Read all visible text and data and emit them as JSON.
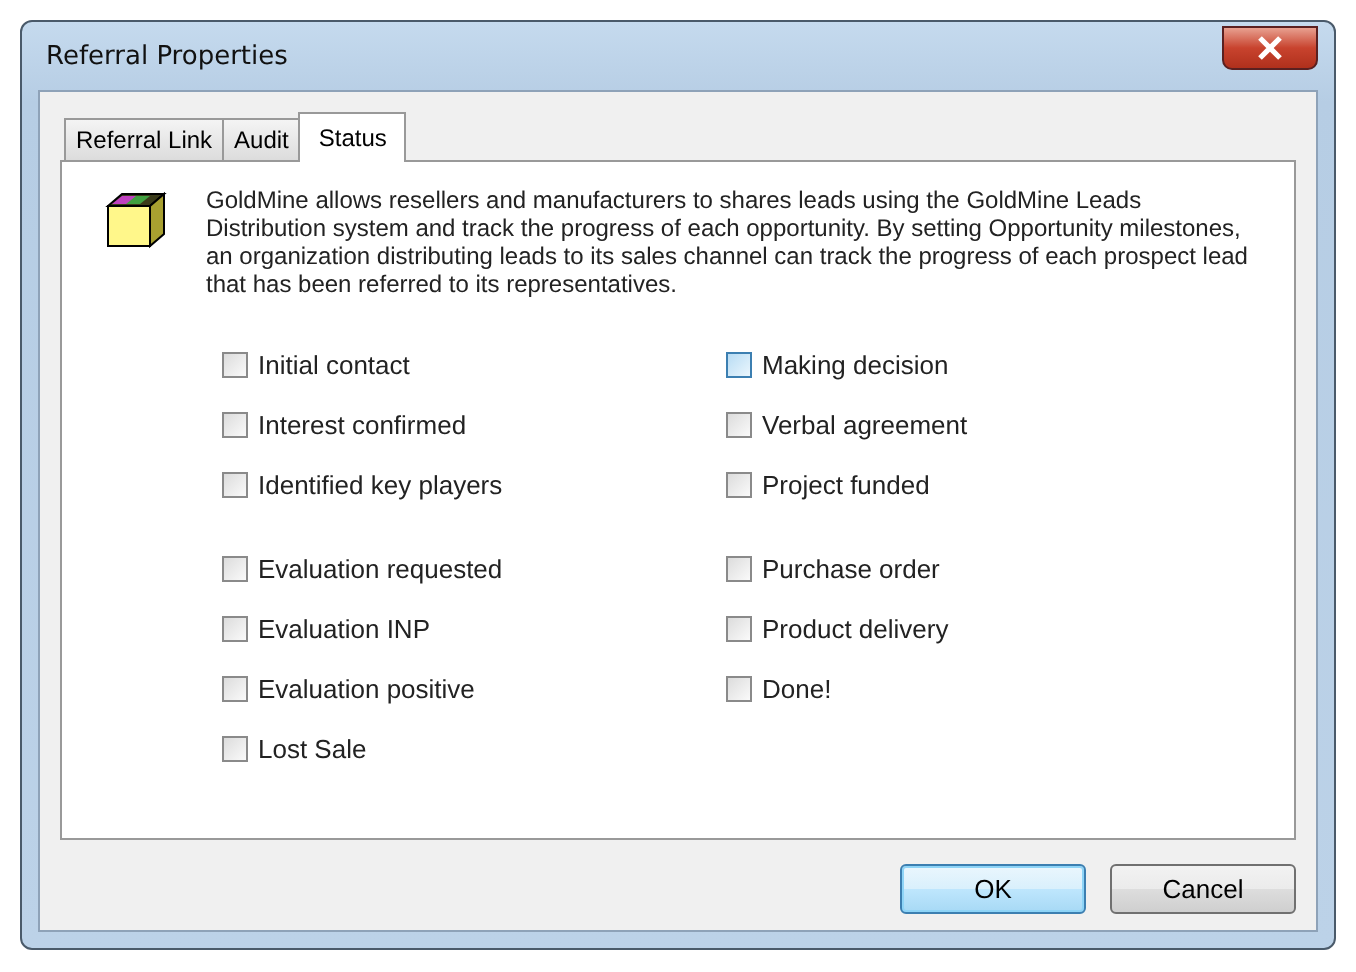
{
  "window": {
    "title": "Referral Properties"
  },
  "tabs": [
    {
      "label": "Referral Link",
      "selected": false
    },
    {
      "label": "Audit",
      "selected": false
    },
    {
      "label": "Status",
      "selected": true
    }
  ],
  "description": "GoldMine allows resellers and manufacturers to shares leads using the GoldMine Leads Distribution system and track the progress of each opportunity.  By setting Opportunity milestones, an organization distributing leads to its sales channel can track the progress of each prospect lead that has been referred to its representatives.",
  "milestone_groups": [
    {
      "left": [
        {
          "label": "Initial contact",
          "checked": false,
          "hovered": false
        },
        {
          "label": "Interest confirmed",
          "checked": false,
          "hovered": false
        },
        {
          "label": "Identified key players",
          "checked": false,
          "hovered": false
        }
      ],
      "right": [
        {
          "label": "Making decision",
          "checked": false,
          "hovered": true
        },
        {
          "label": "Verbal agreement",
          "checked": false,
          "hovered": false
        },
        {
          "label": "Project funded",
          "checked": false,
          "hovered": false
        }
      ]
    },
    {
      "left": [
        {
          "label": "Evaluation requested",
          "checked": false,
          "hovered": false
        },
        {
          "label": "Evaluation INP",
          "checked": false,
          "hovered": false
        },
        {
          "label": "Evaluation positive",
          "checked": false,
          "hovered": false
        },
        {
          "label": "Lost Sale",
          "checked": false,
          "hovered": false
        }
      ],
      "right": [
        {
          "label": "Purchase order",
          "checked": false,
          "hovered": false
        },
        {
          "label": "Product delivery",
          "checked": false,
          "hovered": false
        },
        {
          "label": "Done!",
          "checked": false,
          "hovered": false
        }
      ]
    }
  ],
  "buttons": [
    {
      "label": "OK",
      "default": true
    },
    {
      "label": "Cancel",
      "default": false
    }
  ]
}
